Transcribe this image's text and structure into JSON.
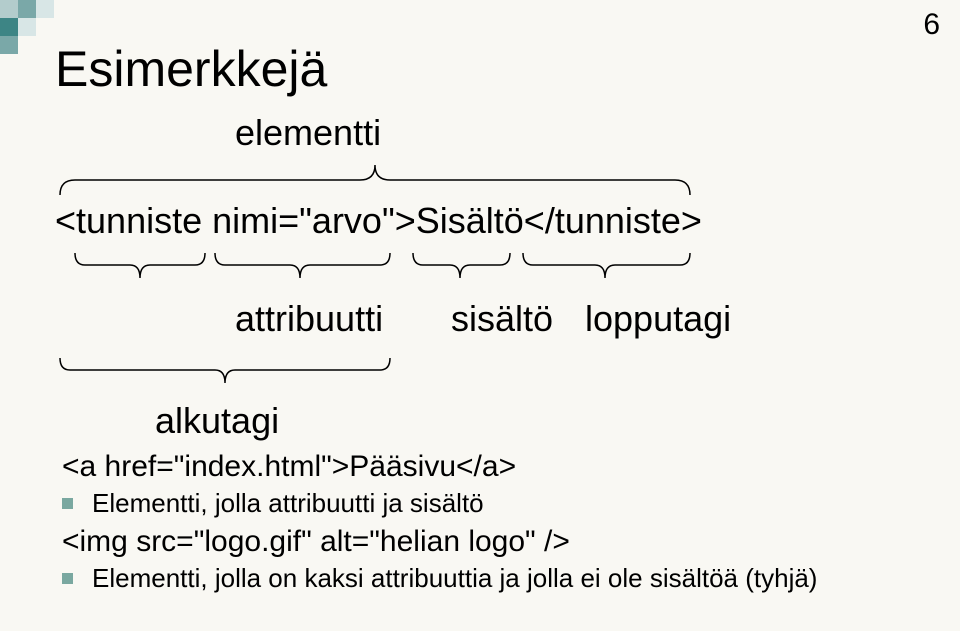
{
  "page_number": "6",
  "title": "Esimerkkejä",
  "labels": {
    "elementti": "elementti",
    "attribuutti": "attribuutti",
    "sisalto": "sisältö",
    "lopputagi": "lopputagi",
    "alkutagi": "alkutagi"
  },
  "tag_example": "<tunniste nimi=\"arvo\">Sisältö</tunniste>",
  "code1": "<a href=\"index.html\">Pääsivu</a>",
  "bullet1": "Elementti, jolla attribuutti ja sisältö",
  "code2": "<img src=\"logo.gif\" alt=\"helian logo\" />",
  "bullet2": "Elementti, jolla on kaksi attribuuttia ja jolla ei ole sisältöä (tyhjä)"
}
